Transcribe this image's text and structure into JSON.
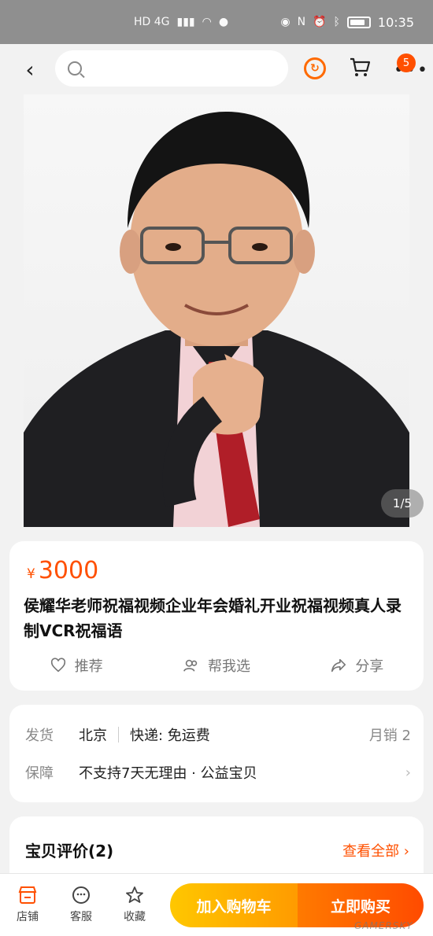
{
  "status_bar": {
    "network": "HD 4G",
    "time": "10:35"
  },
  "header": {
    "back_icon": "‹",
    "search": {
      "placeholder": "",
      "value": ""
    },
    "cart_badge": "5"
  },
  "gallery": {
    "counter": "1/5"
  },
  "product": {
    "currency": "¥",
    "price": "3000",
    "title": "侯耀华老师祝福视频企业年会婚礼开业祝福视频真人录制VCR祝福语",
    "actions": [
      {
        "label": "推荐",
        "icon": "heart-icon"
      },
      {
        "label": "帮我选",
        "icon": "group-icon"
      },
      {
        "label": "分享",
        "icon": "share-icon"
      }
    ]
  },
  "shipping": {
    "ship_label": "发货",
    "origin": "北京",
    "delivery": "快递: 免运费",
    "monthly_sales": "月销 2",
    "guarantee_label": "保障",
    "guarantee": "不支持7天无理由 · 公益宝贝"
  },
  "reviews": {
    "title": "宝贝评价(2)",
    "view_all": "查看全部 ›"
  },
  "bottom_bar": {
    "tabs": [
      {
        "label": "店铺",
        "icon": "store-icon"
      },
      {
        "label": "客服",
        "icon": "customer-service-icon"
      },
      {
        "label": "收藏",
        "icon": "star-icon"
      }
    ],
    "add_to_cart": "加入购物车",
    "buy_now": "立即购买"
  },
  "watermark": "GAMERSKY",
  "colors": {
    "accent": "#ff5000",
    "cart_button": "#ffb000",
    "buy_button": "#ff5a00"
  }
}
